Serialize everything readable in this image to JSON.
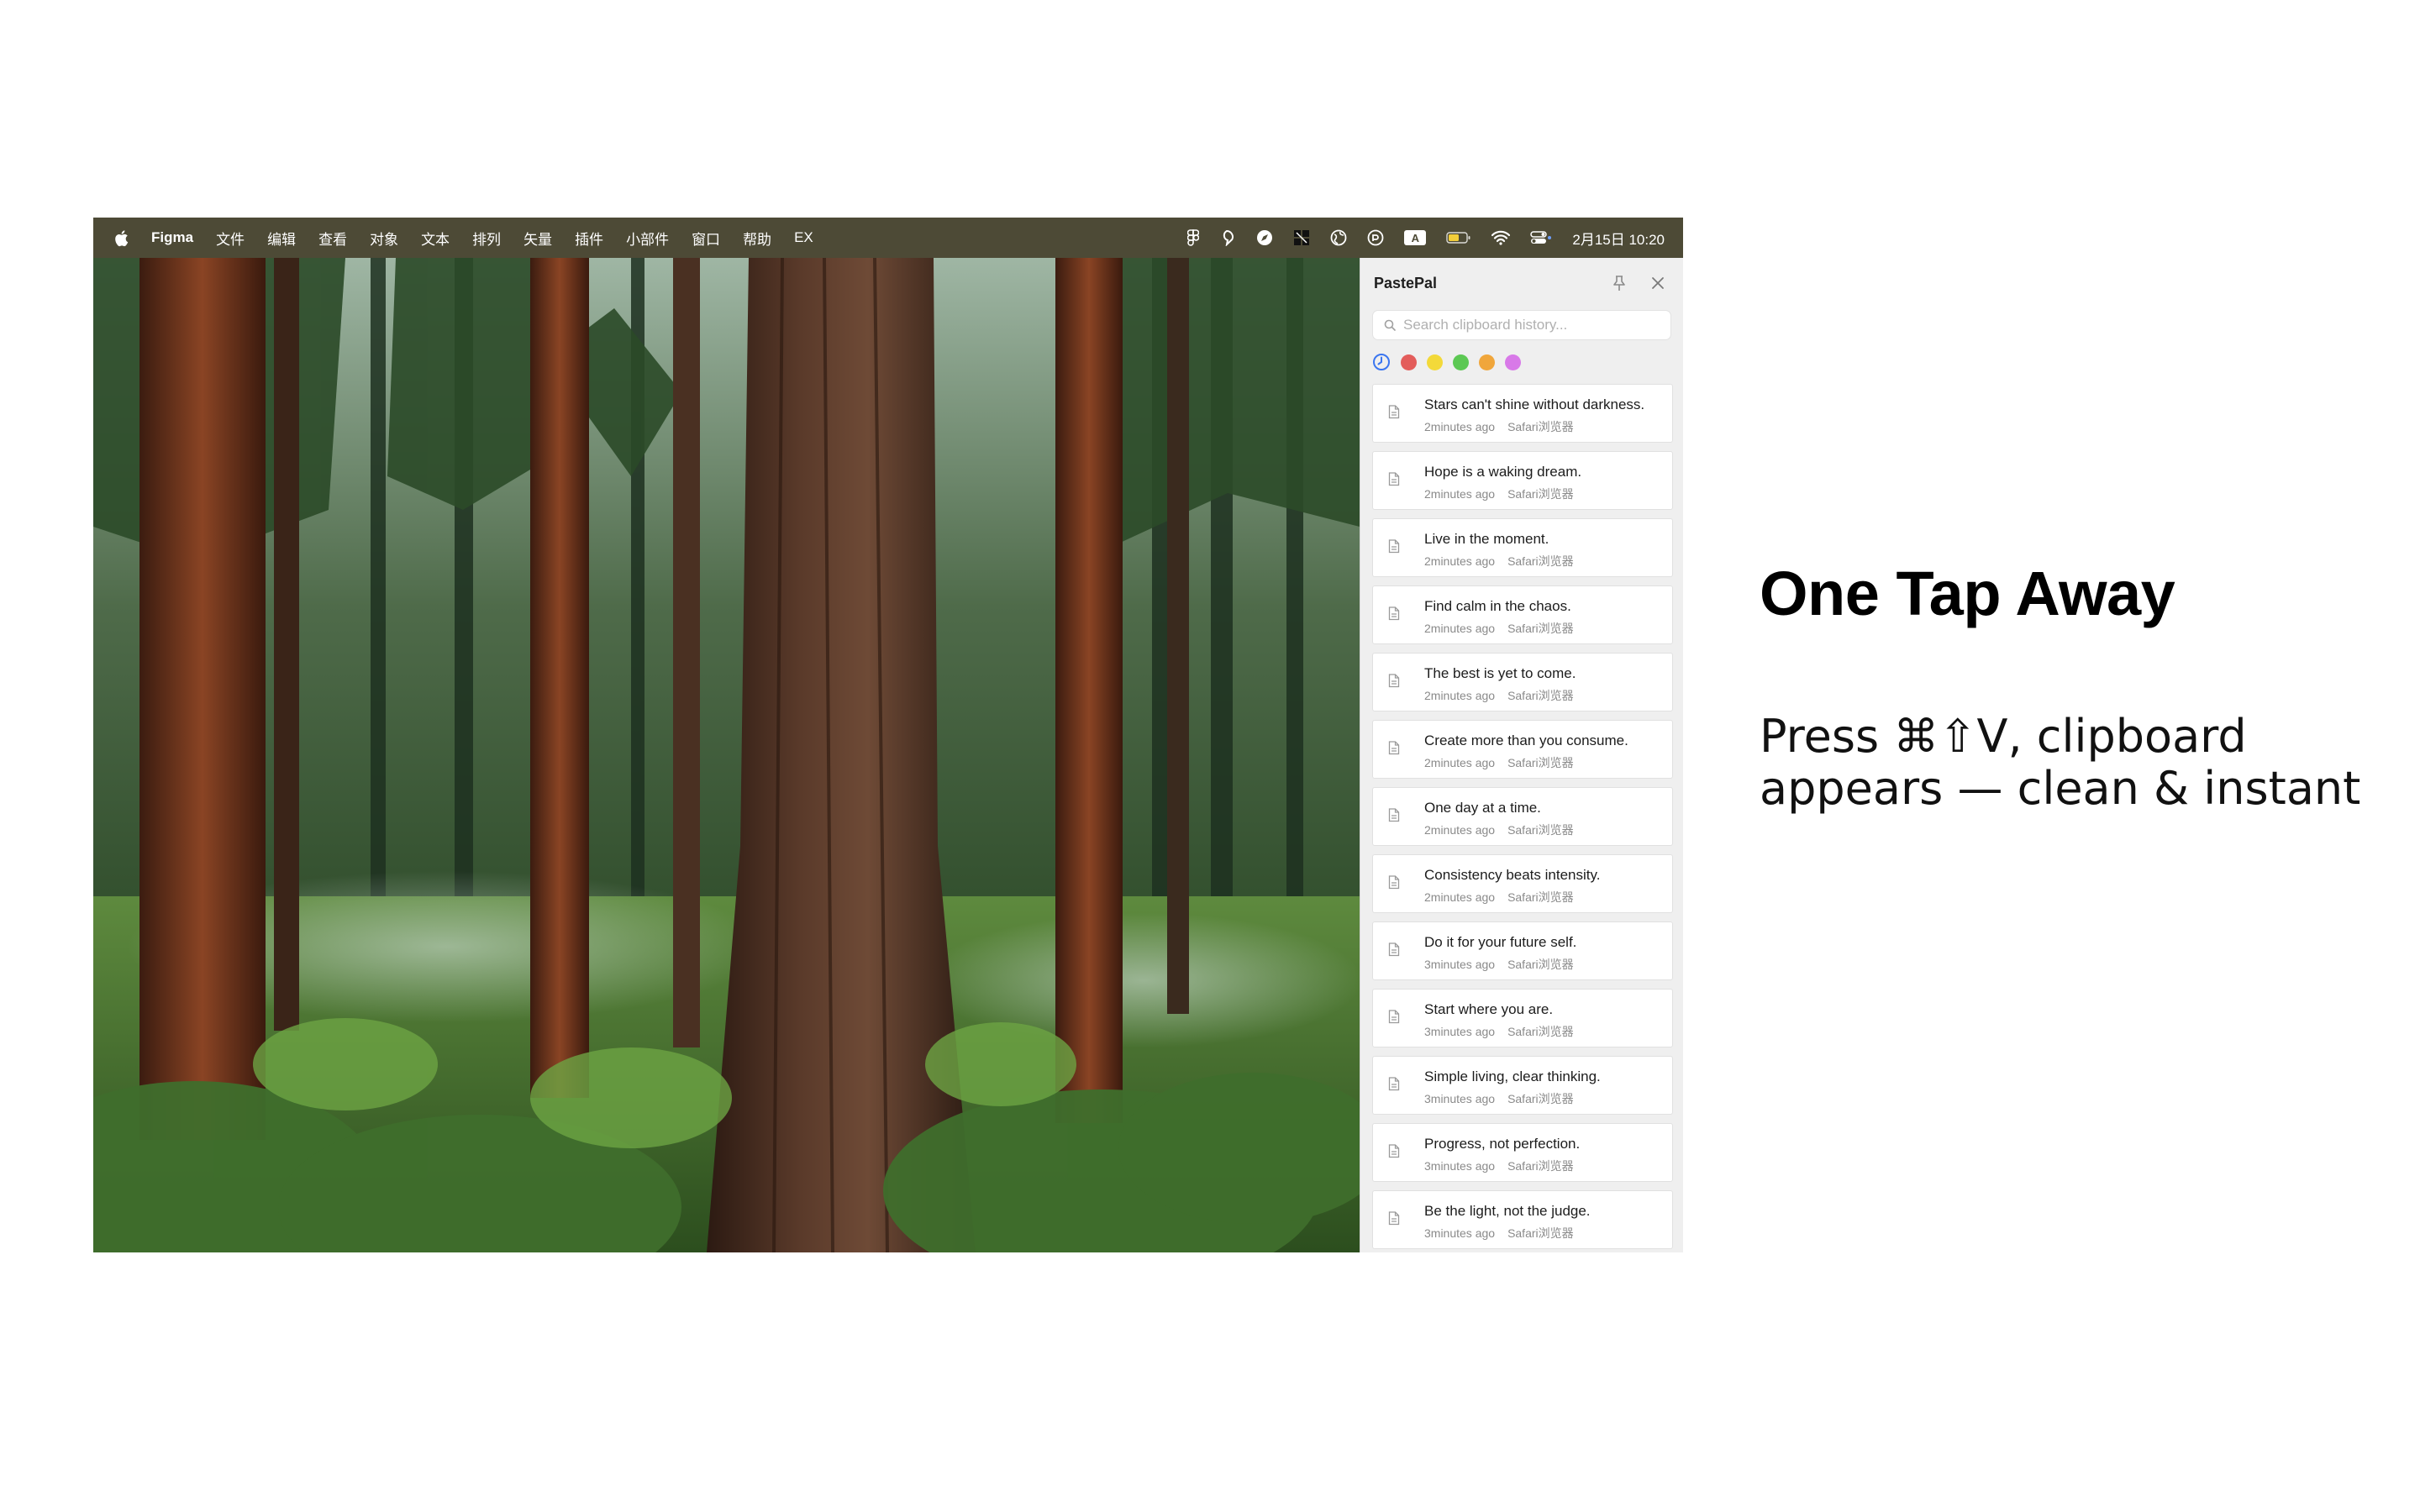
{
  "menubar": {
    "app_name": "Figma",
    "menus": [
      "文件",
      "编辑",
      "查看",
      "对象",
      "文本",
      "排列",
      "矢量",
      "插件",
      "小部件",
      "窗口",
      "帮助",
      "EX"
    ],
    "ime_label": "A",
    "clock": "2月15日  10:20"
  },
  "panel": {
    "title": "PastePal",
    "search_placeholder": "Search clipboard history...",
    "filter_colors": [
      "#e35d5b",
      "#f3d939",
      "#5cc853",
      "#f0a63b",
      "#d879e8"
    ],
    "accent": "#3b76f0",
    "items": [
      {
        "text": "Stars can't shine without darkness.",
        "time": "2minutes ago",
        "source": "Safari浏览器"
      },
      {
        "text": "Hope is a waking dream.",
        "time": "2minutes ago",
        "source": "Safari浏览器"
      },
      {
        "text": "Live in the moment.",
        "time": "2minutes ago",
        "source": "Safari浏览器"
      },
      {
        "text": "Find calm in the chaos.",
        "time": "2minutes ago",
        "source": "Safari浏览器"
      },
      {
        "text": "The best is yet to come.",
        "time": "2minutes ago",
        "source": "Safari浏览器"
      },
      {
        "text": "Create more than you consume.",
        "time": "2minutes ago",
        "source": "Safari浏览器"
      },
      {
        "text": "One day at a time.",
        "time": "2minutes ago",
        "source": "Safari浏览器"
      },
      {
        "text": "Consistency beats intensity.",
        "time": "2minutes ago",
        "source": "Safari浏览器"
      },
      {
        "text": "Do it for your future self.",
        "time": "3minutes ago",
        "source": "Safari浏览器"
      },
      {
        "text": "Start where you are.",
        "time": "3minutes ago",
        "source": "Safari浏览器"
      },
      {
        "text": "Simple living, clear thinking.",
        "time": "3minutes ago",
        "source": "Safari浏览器"
      },
      {
        "text": "Progress, not perfection.",
        "time": "3minutes ago",
        "source": "Safari浏览器"
      },
      {
        "text": "Be the light, not the judge.",
        "time": "3minutes ago",
        "source": "Safari浏览器"
      }
    ]
  },
  "promo": {
    "headline": "One Tap Away",
    "tagline": "Press ⌘⇧V, clipboard appears — clean & instant"
  }
}
